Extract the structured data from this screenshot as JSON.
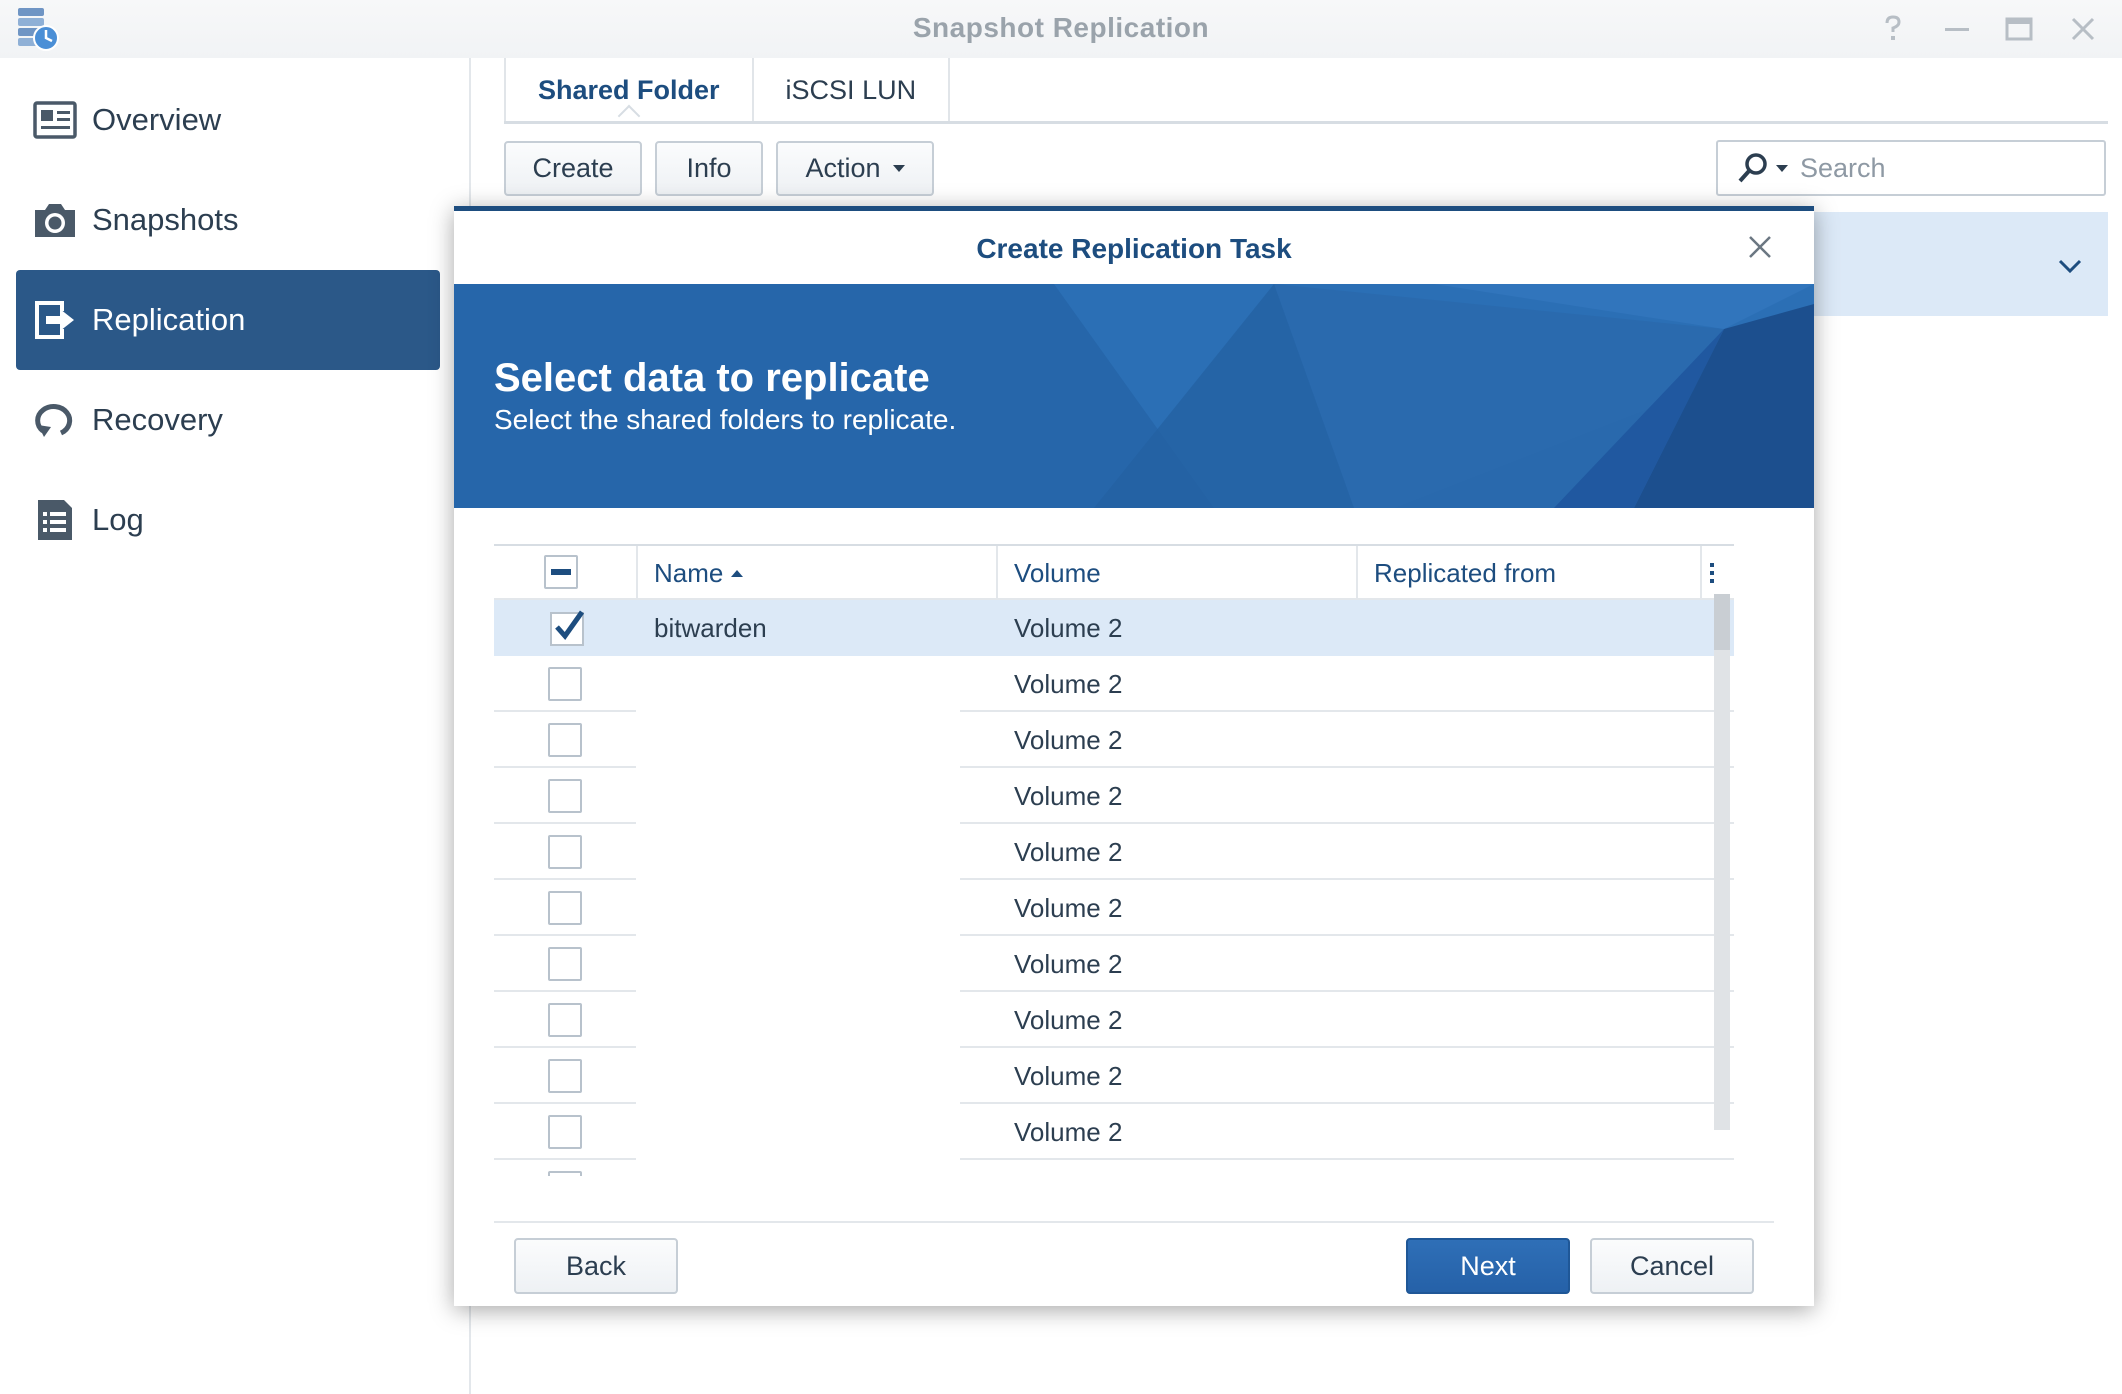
{
  "window": {
    "title": "Snapshot Replication",
    "controls": [
      "help-icon",
      "minimize-icon",
      "maximize-icon",
      "close-icon"
    ]
  },
  "sidebar": {
    "items": [
      {
        "label": "Overview",
        "icon": "overview-icon",
        "active": false
      },
      {
        "label": "Snapshots",
        "icon": "camera-icon",
        "active": false
      },
      {
        "label": "Replication",
        "icon": "replication-icon",
        "active": true
      },
      {
        "label": "Recovery",
        "icon": "recovery-icon",
        "active": false
      },
      {
        "label": "Log",
        "icon": "log-icon",
        "active": false
      }
    ]
  },
  "main": {
    "tabs": [
      {
        "label": "Shared Folder",
        "active": true
      },
      {
        "label": "iSCSI LUN",
        "active": false
      }
    ],
    "toolbar": {
      "create_label": "Create",
      "info_label": "Info",
      "action_label": "Action"
    },
    "search": {
      "placeholder": "Search",
      "value": ""
    }
  },
  "dialog": {
    "title": "Create Replication Task",
    "banner_title": "Select data to replicate",
    "banner_subtitle": "Select the shared folders to replicate.",
    "columns": {
      "name": "Name",
      "volume": "Volume",
      "replicated_from": "Replicated from"
    },
    "rows": [
      {
        "name": "bitwarden",
        "volume": "Volume 2",
        "replicated_from": "",
        "checked": true
      },
      {
        "name": "",
        "volume": "Volume 2",
        "replicated_from": "",
        "checked": false
      },
      {
        "name": "",
        "volume": "Volume 2",
        "replicated_from": "",
        "checked": false
      },
      {
        "name": "",
        "volume": "Volume 2",
        "replicated_from": "",
        "checked": false
      },
      {
        "name": "",
        "volume": "Volume 2",
        "replicated_from": "",
        "checked": false
      },
      {
        "name": "",
        "volume": "Volume 2",
        "replicated_from": "",
        "checked": false
      },
      {
        "name": "",
        "volume": "Volume 2",
        "replicated_from": "",
        "checked": false
      },
      {
        "name": "",
        "volume": "Volume 2",
        "replicated_from": "",
        "checked": false
      },
      {
        "name": "",
        "volume": "Volume 2",
        "replicated_from": "",
        "checked": false
      },
      {
        "name": "",
        "volume": "Volume 2",
        "replicated_from": "",
        "checked": false
      }
    ],
    "buttons": {
      "back": "Back",
      "next": "Next",
      "cancel": "Cancel"
    }
  },
  "colors": {
    "accent": "#1d4d7f",
    "sidebar_active": "#2b5888",
    "banner": "#2565a8",
    "selected_row": "#dce9f7",
    "primary_button": "#2a68b0"
  }
}
